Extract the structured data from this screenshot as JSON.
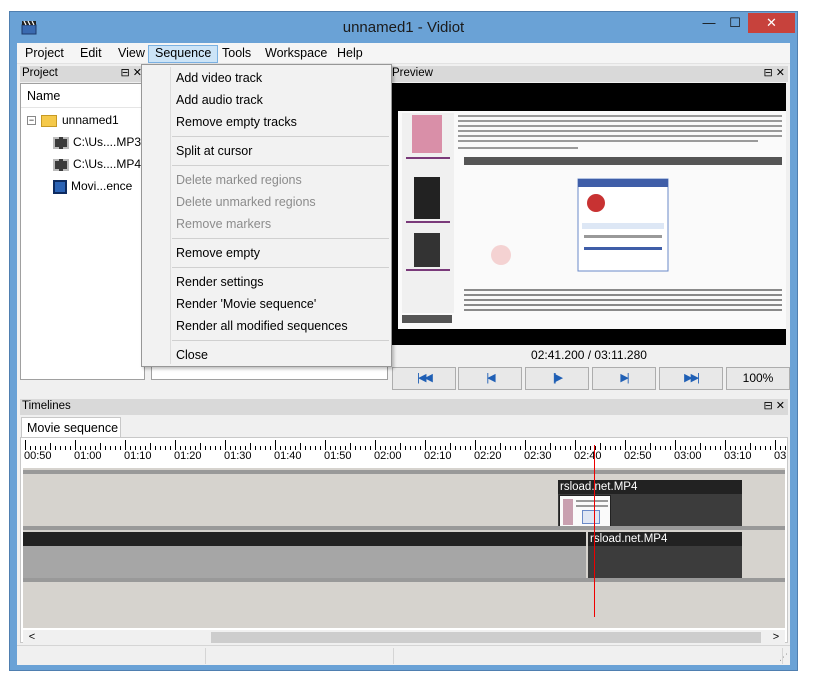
{
  "window": {
    "title": "unnamed1 - Vidiot",
    "minimize": "—",
    "maximize": "☐",
    "close": "✕"
  },
  "menubar": [
    "Project",
    "Edit",
    "View",
    "Sequence",
    "Tools",
    "Workspace",
    "Help"
  ],
  "active_menu": "Sequence",
  "sequence_menu": {
    "items": [
      {
        "label": "Add video track",
        "enabled": true
      },
      {
        "label": "Add audio track",
        "enabled": true
      },
      {
        "label": "Remove empty tracks",
        "enabled": true
      },
      {
        "label": "Split at cursor",
        "enabled": true
      },
      {
        "label": "Delete marked regions",
        "enabled": false
      },
      {
        "label": "Delete unmarked regions",
        "enabled": false
      },
      {
        "label": "Remove markers",
        "enabled": false
      },
      {
        "label": "Remove empty",
        "enabled": true
      },
      {
        "label": "Render settings",
        "enabled": true
      },
      {
        "label": "Render 'Movie sequence'",
        "enabled": true
      },
      {
        "label": "Render all modified sequences",
        "enabled": true
      },
      {
        "label": "Close",
        "enabled": true
      }
    ]
  },
  "project_panel": {
    "title": "Project",
    "column_header": "Name",
    "root": "unnamed1",
    "items": [
      "C:\\Us....MP3",
      "C:\\Us....MP4",
      "Movi...ence"
    ]
  },
  "preview": {
    "title": "Preview",
    "time": "02:41.200 / 03:11.280",
    "zoom": "100%"
  },
  "timelines": {
    "title": "Timelines",
    "tab": "Movie sequence",
    "ruler_labels": [
      "00:50",
      "01:00",
      "01:10",
      "01:20",
      "01:30",
      "01:40",
      "01:50",
      "02:00",
      "02:10",
      "02:20",
      "02:30",
      "02:40",
      "02:50",
      "03:00",
      "03:10",
      "03"
    ],
    "video_clip": "rsload.net.MP4",
    "audio_clip": "rsload.net.MP4",
    "cursor_time": "02:41.200"
  },
  "panel_icons": "⊟ ✕",
  "scroll": {
    "left": "<",
    "right": ">"
  },
  "colors": {
    "titlebar": "#6aa2d6",
    "close": "#c7423c",
    "menu_highlight": "#cce4f7",
    "cursor": "#ee0000"
  }
}
